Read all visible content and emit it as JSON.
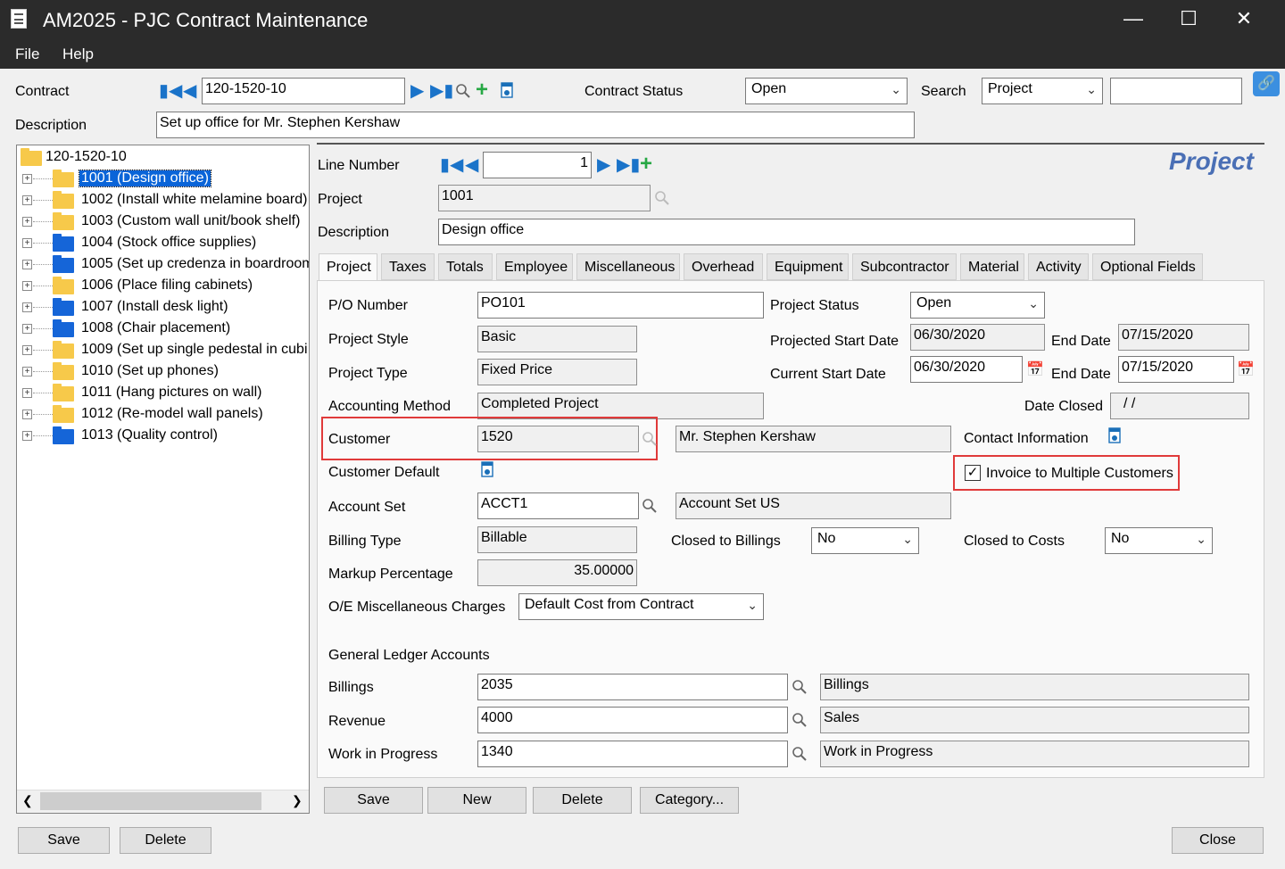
{
  "window": {
    "title": "AM2025 - PJC Contract Maintenance"
  },
  "menu": {
    "file": "File",
    "help": "Help"
  },
  "header": {
    "contract_label": "Contract",
    "contract_value": "120-1520-10",
    "contract_status_label": "Contract Status",
    "contract_status_value": "Open",
    "search_label": "Search",
    "search_by_value": "Project",
    "search_text": "",
    "description_label": "Description",
    "description_value": "Set up office for Mr. Stephen Kershaw"
  },
  "tree": {
    "root": "120-1520-10",
    "items": [
      {
        "label": "1001 (Design office)",
        "color": "yellow"
      },
      {
        "label": "1002 (Install white melamine board)",
        "color": "yellow"
      },
      {
        "label": "1003 (Custom wall unit/book shelf)",
        "color": "yellow"
      },
      {
        "label": "1004 (Stock office supplies)",
        "color": "blue"
      },
      {
        "label": "1005 (Set up credenza in boardroom",
        "color": "blue"
      },
      {
        "label": "1006 (Place filing cabinets)",
        "color": "yellow"
      },
      {
        "label": "1007 (Install desk light)",
        "color": "blue"
      },
      {
        "label": "1008 (Chair placement)",
        "color": "blue"
      },
      {
        "label": "1009 (Set up single pedestal in cubi",
        "color": "yellow"
      },
      {
        "label": "1010 (Set up phones)",
        "color": "yellow"
      },
      {
        "label": "1011 (Hang pictures on wall)",
        "color": "yellow"
      },
      {
        "label": "1012 (Re-model wall panels)",
        "color": "yellow"
      },
      {
        "label": "1013 (Quality control)",
        "color": "blue"
      }
    ]
  },
  "line": {
    "heading": "Project",
    "line_number_label": "Line Number",
    "line_number_value": "1",
    "project_label": "Project",
    "project_value": "1001",
    "description_label": "Description",
    "description_value": "Design office"
  },
  "tabs": [
    "Project",
    "Taxes",
    "Totals",
    "Employee",
    "Miscellaneous",
    "Overhead",
    "Equipment",
    "Subcontractor",
    "Material",
    "Activity",
    "Optional Fields"
  ],
  "project_tab": {
    "po_label": "P/O Number",
    "po_value": "PO101",
    "project_status_label": "Project Status",
    "project_status_value": "Open",
    "project_style_label": "Project Style",
    "project_style_value": "Basic",
    "projected_start_label": "Projected Start Date",
    "projected_start_value": "06/30/2020",
    "end_date_label": "End Date",
    "projected_end_value": "07/15/2020",
    "project_type_label": "Project Type",
    "project_type_value": "Fixed Price",
    "current_start_label": "Current Start Date",
    "current_start_value": "06/30/2020",
    "current_end_value": "07/15/2020",
    "accounting_method_label": "Accounting Method",
    "accounting_method_value": "Completed Project",
    "date_closed_label": "Date Closed",
    "date_closed_value": " /  /",
    "customer_label": "Customer",
    "customer_value": "1520",
    "customer_name": "Mr. Stephen Kershaw",
    "contact_info_label": "Contact Information",
    "customer_default_label": "Customer Default",
    "invoice_multi_label": "Invoice to Multiple Customers",
    "invoice_multi_checked": true,
    "account_set_label": "Account Set",
    "account_set_value": "ACCT1",
    "account_set_desc": "Account Set US",
    "billing_type_label": "Billing Type",
    "billing_type_value": "Billable",
    "closed_billings_label": "Closed to Billings",
    "closed_billings_value": "No",
    "closed_costs_label": "Closed to Costs",
    "closed_costs_value": "No",
    "markup_label": "Markup Percentage",
    "markup_value": "35.00000",
    "oe_misc_label": "O/E Miscellaneous Charges",
    "oe_misc_value": "Default Cost from Contract",
    "gl_heading": "General Ledger Accounts",
    "billings_label": "Billings",
    "billings_value": "2035",
    "billings_desc": "Billings",
    "revenue_label": "Revenue",
    "revenue_value": "4000",
    "revenue_desc": "Sales",
    "wip_label": "Work in Progress",
    "wip_value": "1340",
    "wip_desc": "Work in Progress"
  },
  "buttons": {
    "save": "Save",
    "new": "New",
    "delete": "Delete",
    "category": "Category...",
    "bottom_save": "Save",
    "bottom_delete": "Delete",
    "close": "Close"
  },
  "colors": {
    "titlebar": "#2b2b2b",
    "accent": "#1a73c9",
    "highlight_box": "#e03a3a",
    "selection": "#0a64d8",
    "heading": "#4a6fb5"
  }
}
